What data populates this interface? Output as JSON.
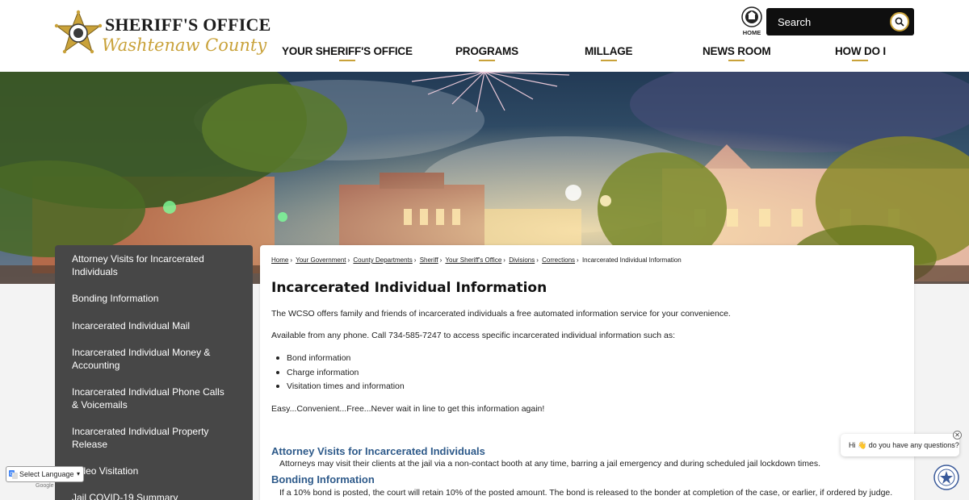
{
  "header": {
    "logo_line1": "SHERIFF'S OFFICE",
    "logo_line2": "Washtenaw County",
    "home_label": "HOME",
    "search_placeholder": "Search"
  },
  "nav": [
    {
      "label": "YOUR SHERIFF'S OFFICE"
    },
    {
      "label": "PROGRAMS"
    },
    {
      "label": "MILLAGE"
    },
    {
      "label": "NEWS ROOM"
    },
    {
      "label": "HOW DO I"
    }
  ],
  "sidebar": {
    "items": [
      {
        "label": "Attorney Visits for Incarcerated Individuals"
      },
      {
        "label": "Bonding Information"
      },
      {
        "label": "Incarcerated Individual Mail"
      },
      {
        "label": "Incarcerated Individual Money & Accounting"
      },
      {
        "label": "Incarcerated Individual Phone Calls & Voicemails"
      },
      {
        "label": "Incarcerated Individual Property Release"
      },
      {
        "label": "Video Visitation"
      },
      {
        "label": "Jail COVID-19 Summary"
      }
    ]
  },
  "breadcrumb": [
    "Home",
    "Your Government",
    "County Departments",
    "Sheriff",
    "Your Sheriff's Office",
    "Divisions",
    "Corrections",
    "Incarcerated Individual Information"
  ],
  "content": {
    "title": "Incarcerated Individual Information",
    "intro": "The WCSO offers family and friends of incarcerated individuals a free automated information service for your convenience.",
    "phone_line": "Available from any phone. Call 734-585-7247 to access specific incarcerated individual information such as:",
    "bullets": [
      "Bond information",
      "Charge information",
      "Visitation times and information"
    ],
    "tagline": "Easy...Convenient...Free...Never wait in line to get this information again!",
    "sections": [
      {
        "heading": "Attorney Visits for Incarcerated Individuals",
        "text": "Attorneys may visit their clients at the jail via a non-contact booth at any time, barring a jail emergency and during scheduled jail lockdown times."
      },
      {
        "heading": "Bonding Information",
        "text": "If a 10% bond is posted, the court will retain 10% of the posted amount. The bond is released to the bonder at completion of the case, or earlier, if ordered by judge."
      }
    ]
  },
  "chat": {
    "message": "Hi 👋 do you have any questions?",
    "close": "✕"
  },
  "translate": {
    "label": "Select Language",
    "powered_by": "Google"
  },
  "colors": {
    "gold": "#c9a23a",
    "sidebar_bg": "#474747",
    "link_blue": "#2e5a8a",
    "search_bg": "#0f0f0f"
  }
}
